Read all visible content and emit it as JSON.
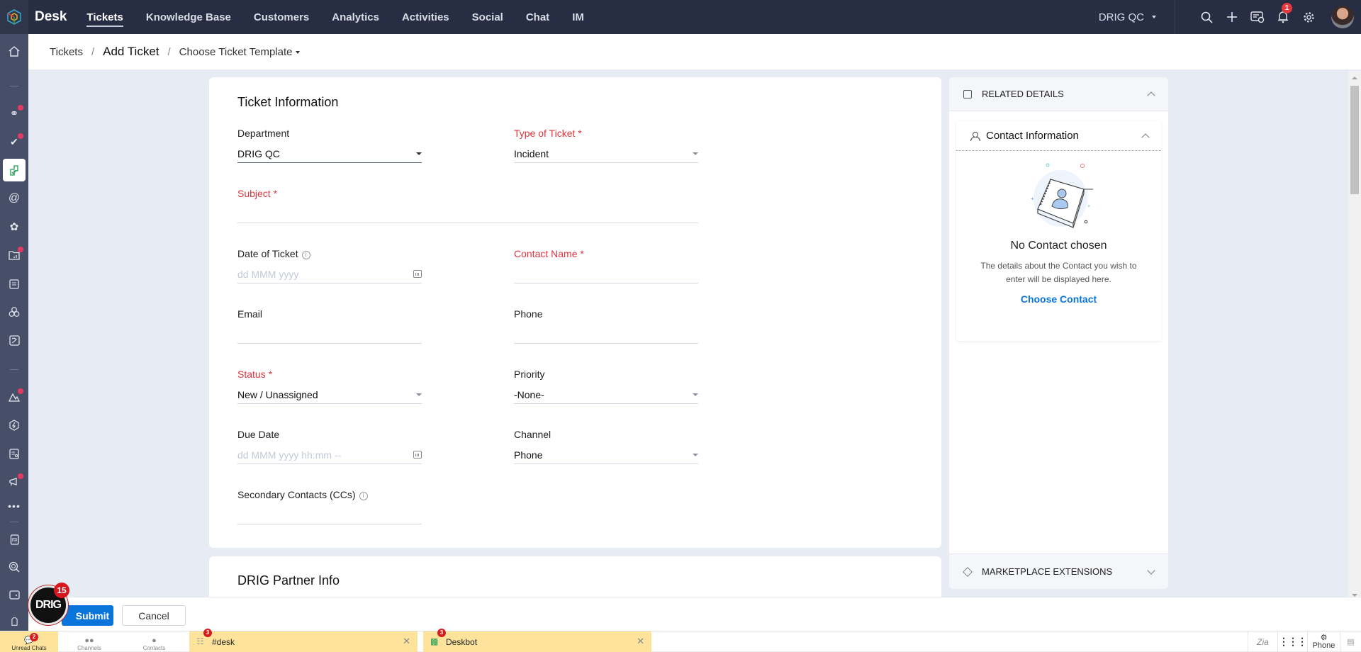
{
  "topbar": {
    "app_name": "Desk",
    "nav": [
      "Tickets",
      "Knowledge Base",
      "Customers",
      "Analytics",
      "Activities",
      "Social",
      "Chat",
      "IM"
    ],
    "active_nav": "Tickets",
    "org_selector": "DRIG QC",
    "notification_count": "1",
    "icons": [
      "search-icon",
      "plus-icon",
      "ticket-info-icon",
      "bell-icon",
      "gear-icon",
      "avatar"
    ]
  },
  "sidebar": {
    "icons": [
      "home-icon",
      "tickets-link-icon",
      "approvals-icon",
      "add-ticket-icon",
      "mentions-icon",
      "flower-icon",
      "folder-chart-icon",
      "notes-icon",
      "community-icon",
      "bank-icon",
      "mountain-icon",
      "zap-icon",
      "report-icon",
      "megaphone-icon",
      "more-icon",
      "journal-icon",
      "search-zoom-icon",
      "wallet-icon",
      "tag-icon"
    ],
    "active": "add-ticket-icon"
  },
  "breadcrumb": {
    "root": "Tickets",
    "current": "Add Ticket",
    "template_selector": "Choose Ticket Template"
  },
  "form": {
    "section_title": "Ticket Information",
    "fields": {
      "department": {
        "label": "Department",
        "value": "DRIG QC"
      },
      "type_of_ticket": {
        "label": "Type of Ticket *",
        "value": "Incident"
      },
      "subject": {
        "label": "Subject *",
        "value": ""
      },
      "date_of_ticket": {
        "label": "Date of Ticket",
        "placeholder": "dd MMM yyyy"
      },
      "contact_name": {
        "label": "Contact Name *",
        "value": ""
      },
      "email": {
        "label": "Email",
        "value": ""
      },
      "phone": {
        "label": "Phone",
        "value": ""
      },
      "status": {
        "label": "Status *",
        "value": "New / Unassigned"
      },
      "priority": {
        "label": "Priority",
        "value": "-None-"
      },
      "due_date": {
        "label": "Due Date",
        "placeholder": "dd MMM yyyy hh:mm --"
      },
      "channel": {
        "label": "Channel",
        "value": "Phone"
      },
      "secondary_contacts": {
        "label": "Secondary Contacts (CCs)",
        "value": ""
      }
    },
    "next_section_title": "DRIG Partner Info"
  },
  "related_details": {
    "header": "RELATED DETAILS",
    "contact_info_title": "Contact Information",
    "empty_title": "No Contact chosen",
    "empty_desc": "The details about the Contact you wish to enter will be displayed here.",
    "choose_link": "Choose Contact",
    "marketplace": "MARKETPLACE EXTENSIONS"
  },
  "actions": {
    "submit": "Submit",
    "cancel": "Cancel"
  },
  "chat_bubble": {
    "label": "DRIG",
    "badge": "15"
  },
  "chatbar": {
    "tabs": [
      {
        "label": "Unread Chats",
        "badge": "2"
      },
      {
        "label": "Channels"
      },
      {
        "label": "Contacts"
      }
    ],
    "windows": [
      {
        "name": "#desk",
        "badge": "3"
      },
      {
        "name": "Deskbot",
        "badge": "3"
      }
    ],
    "right": {
      "zia": "Zia",
      "phone": "Phone"
    }
  },
  "colors": {
    "topbar": "#272d42",
    "sidebar": "#474e68",
    "accent": "#0a74da",
    "required": "#e0353f",
    "chat_highlight": "#fde39c"
  }
}
